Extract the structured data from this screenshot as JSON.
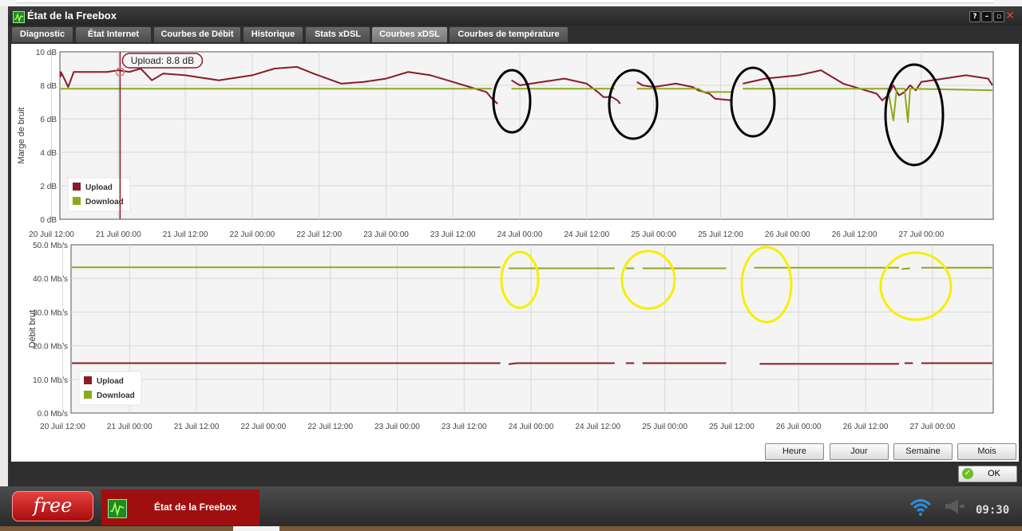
{
  "window": {
    "title": "État de la Freebox",
    "help": "?"
  },
  "tabs": [
    {
      "label": "Diagnostic",
      "active": false
    },
    {
      "label": "État Internet",
      "active": false
    },
    {
      "label": "Courbes de Débit",
      "active": false
    },
    {
      "label": "Historique",
      "active": false
    },
    {
      "label": "Stats xDSL",
      "active": false
    },
    {
      "label": "Courbes xDSL",
      "active": true
    },
    {
      "label": "Courbes de température",
      "active": false
    }
  ],
  "colors": {
    "upload": "#8b1a28",
    "download": "#8ea81e",
    "black_circle": "#000000",
    "yellow_circle": "#f3f000"
  },
  "chart_data": [
    {
      "type": "line",
      "ylabel": "Marge de bruit",
      "y_ticks": [
        "10 dB",
        "8 dB",
        "6 dB",
        "4 dB",
        "2 dB",
        "0 dB"
      ],
      "ylim": [
        0,
        10
      ],
      "x_ticks": [
        "20 Juil 12:00",
        "21 Juil 00:00",
        "21 Juil 12:00",
        "22 Juil 00:00",
        "22 Juil 12:00",
        "23 Juil 00:00",
        "23 Juil 12:00",
        "24 Juil 00:00",
        "24 Juil 12:00",
        "25 Juil 00:00",
        "25 Juil 12:00",
        "26 Juil 00:00",
        "26 Juil 12:00",
        "27 Juil 00:00"
      ],
      "x_hours": [
        0,
        12,
        24,
        36,
        48,
        60,
        72,
        84,
        96,
        108,
        120,
        132,
        144,
        156
      ],
      "legend": [
        "Upload",
        "Download"
      ],
      "legend_placement": "bottom-left",
      "tooltip": "Upload: 8.8 dB",
      "series": [
        {
          "name": "Upload",
          "points": [
            [
              -2,
              8.5
            ],
            [
              0,
              8.8
            ],
            [
              2,
              8.6
            ],
            [
              3,
              7.9
            ],
            [
              4,
              8.8
            ],
            [
              10,
              8.8
            ],
            [
              12,
              8.9
            ],
            [
              14,
              8.8
            ],
            [
              16,
              9.0
            ],
            [
              18,
              8.3
            ],
            [
              20,
              8.7
            ],
            [
              24,
              8.6
            ],
            [
              30,
              8.3
            ],
            [
              36,
              8.6
            ],
            [
              40,
              9.0
            ],
            [
              44,
              9.1
            ],
            [
              47,
              8.7
            ],
            [
              52,
              8.1
            ],
            [
              56,
              8.2
            ],
            [
              60,
              8.4
            ],
            [
              64,
              8.8
            ],
            [
              68,
              8.6
            ],
            [
              71,
              8.3
            ],
            [
              74,
              8.0
            ],
            [
              77,
              7.7
            ],
            [
              78,
              7.6
            ],
            [
              79,
              7.2
            ],
            [
              80,
              6.9
            ],
            [
              null,
              null
            ],
            [
              82.5,
              8.3
            ],
            [
              84,
              8.0
            ],
            [
              88,
              8.2
            ],
            [
              92,
              8.4
            ],
            [
              96,
              8.1
            ],
            [
              98,
              7.6
            ],
            [
              99,
              7.3
            ],
            [
              100.5,
              7.3
            ],
            [
              101.5,
              7.1
            ],
            [
              102,
              6.9
            ],
            [
              null,
              null
            ],
            [
              105,
              8.2
            ],
            [
              106,
              8.0
            ],
            [
              108,
              7.9
            ],
            [
              112,
              8.1
            ],
            [
              115,
              7.9
            ],
            [
              116,
              7.7
            ],
            [
              118,
              7.5
            ],
            [
              119,
              7.2
            ],
            [
              122,
              7.1
            ],
            [
              null,
              null
            ],
            [
              124,
              8.1
            ],
            [
              128,
              8.4
            ],
            [
              134,
              8.6
            ],
            [
              138,
              8.9
            ],
            [
              142,
              8.1
            ],
            [
              146,
              7.7
            ],
            [
              148,
              7.5
            ],
            [
              149,
              7.1
            ],
            [
              150,
              7.4
            ],
            [
              151,
              8.0
            ],
            [
              152,
              7.4
            ],
            [
              153,
              7.6
            ],
            [
              154,
              8.0
            ],
            [
              155,
              7.7
            ],
            [
              156,
              8.2
            ],
            [
              160,
              8.4
            ],
            [
              164,
              8.6
            ],
            [
              168,
              8.4
            ],
            [
              170,
              8.0
            ]
          ]
        },
        {
          "name": "Download",
          "points": [
            [
              -2,
              7.8
            ],
            [
              79,
              7.8
            ],
            [
              null,
              null
            ],
            [
              82.5,
              7.8
            ],
            [
              101,
              7.8
            ],
            [
              null,
              null
            ],
            [
              105,
              7.8
            ],
            [
              116,
              7.8
            ],
            [
              117,
              7.6
            ],
            [
              122,
              7.6
            ],
            [
              null,
              null
            ],
            [
              124,
              7.8
            ],
            [
              150,
              7.8
            ],
            [
              151,
              5.9
            ],
            [
              151.6,
              7.8
            ],
            [
              153,
              7.8
            ],
            [
              153.6,
              5.8
            ],
            [
              154,
              7.8
            ],
            [
              170,
              7.7
            ]
          ]
        }
      ]
    },
    {
      "type": "line",
      "ylabel": "Débit brut",
      "y_ticks": [
        "50.0 Mb/s",
        "40.0 Mb/s",
        "30.0 Mb/s",
        "20.0 Mb/s",
        "10.0 Mb/s",
        "0.0 Mb/s"
      ],
      "ylim": [
        0,
        50
      ],
      "x_ticks": [
        "20 Juil 12:00",
        "21 Juil 00:00",
        "21 Juil 12:00",
        "22 Juil 00:00",
        "22 Juil 12:00",
        "23 Juil 00:00",
        "23 Juil 12:00",
        "24 Juil 00:00",
        "24 Juil 12:00",
        "25 Juil 00:00",
        "25 Juil 12:00",
        "26 Juil 00:00",
        "26 Juil 12:00",
        "27 Juil 00:00"
      ],
      "x_hours": [
        0,
        12,
        24,
        36,
        48,
        60,
        72,
        84,
        96,
        108,
        120,
        132,
        144,
        156
      ],
      "legend": [
        "Upload",
        "Download"
      ],
      "legend_placement": "bottom-left",
      "series": [
        {
          "name": "Upload",
          "points": [
            [
              -2,
              14.8
            ],
            [
              78.5,
              14.8
            ],
            [
              null,
              null
            ],
            [
              80,
              14.5
            ],
            [
              81.5,
              14.8
            ],
            [
              99,
              14.8
            ],
            [
              null,
              null
            ],
            [
              101,
              14.8
            ],
            [
              102.5,
              14.8
            ],
            [
              null,
              null
            ],
            [
              104,
              14.8
            ],
            [
              119,
              14.8
            ],
            [
              null,
              null
            ],
            [
              122,
              14.8
            ],
            [
              null,
              null
            ],
            [
              125,
              14.6
            ],
            [
              150,
              14.6
            ],
            [
              null,
              null
            ],
            [
              151,
              14.8
            ],
            [
              152.5,
              14.8
            ],
            [
              null,
              null
            ],
            [
              154,
              14.8
            ],
            [
              170,
              14.8
            ]
          ]
        },
        {
          "name": "Download",
          "points": [
            [
              -2,
              43.3
            ],
            [
              78.5,
              43.3
            ],
            [
              null,
              null
            ],
            [
              80,
              43.0
            ],
            [
              99,
              43.0
            ],
            [
              null,
              null
            ],
            [
              101,
              43.0
            ],
            [
              102.5,
              43.0
            ],
            [
              null,
              null
            ],
            [
              104,
              43.0
            ],
            [
              119,
              43.0
            ],
            [
              null,
              null
            ],
            [
              122,
              43.0
            ],
            [
              null,
              null
            ],
            [
              124,
              43.2
            ],
            [
              150,
              43.2
            ],
            [
              null,
              null
            ],
            [
              150.5,
              42.8
            ],
            [
              152,
              43.0
            ],
            [
              null,
              null
            ],
            [
              154,
              43.2
            ],
            [
              170,
              43.2
            ]
          ]
        }
      ]
    }
  ],
  "buttons": {
    "heure": "Heure",
    "jour": "Jour",
    "semaine": "Semaine",
    "mois": "Mois",
    "ok": "OK"
  },
  "taskbar": {
    "start_label": "free",
    "item_label": "État de la Freebox",
    "clock": "09:30"
  }
}
